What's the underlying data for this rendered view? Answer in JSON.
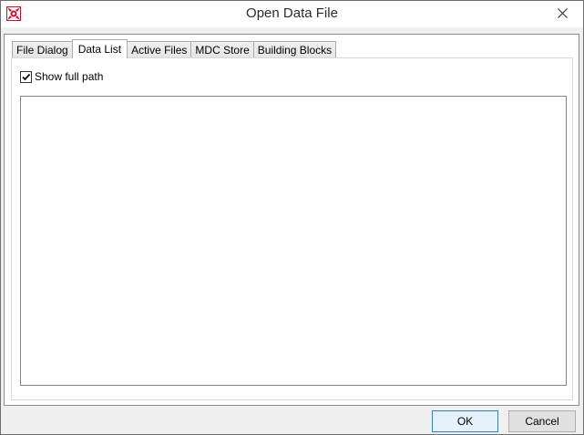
{
  "window": {
    "title": "Open Data File"
  },
  "tabs": [
    {
      "label": "File Dialog"
    },
    {
      "label": "Data List"
    },
    {
      "label": "Active Files"
    },
    {
      "label": "MDC Store"
    },
    {
      "label": "Building Blocks"
    }
  ],
  "active_tab": "Data List",
  "options": {
    "show_full_path_label": "Show full path",
    "show_full_path_checked": true
  },
  "data_list": {
    "items": []
  },
  "footer": {
    "ok_label": "OK",
    "cancel_label": "Cancel"
  },
  "colors": {
    "accent": "#3c7fb1",
    "app_icon_red": "#c8102e"
  }
}
